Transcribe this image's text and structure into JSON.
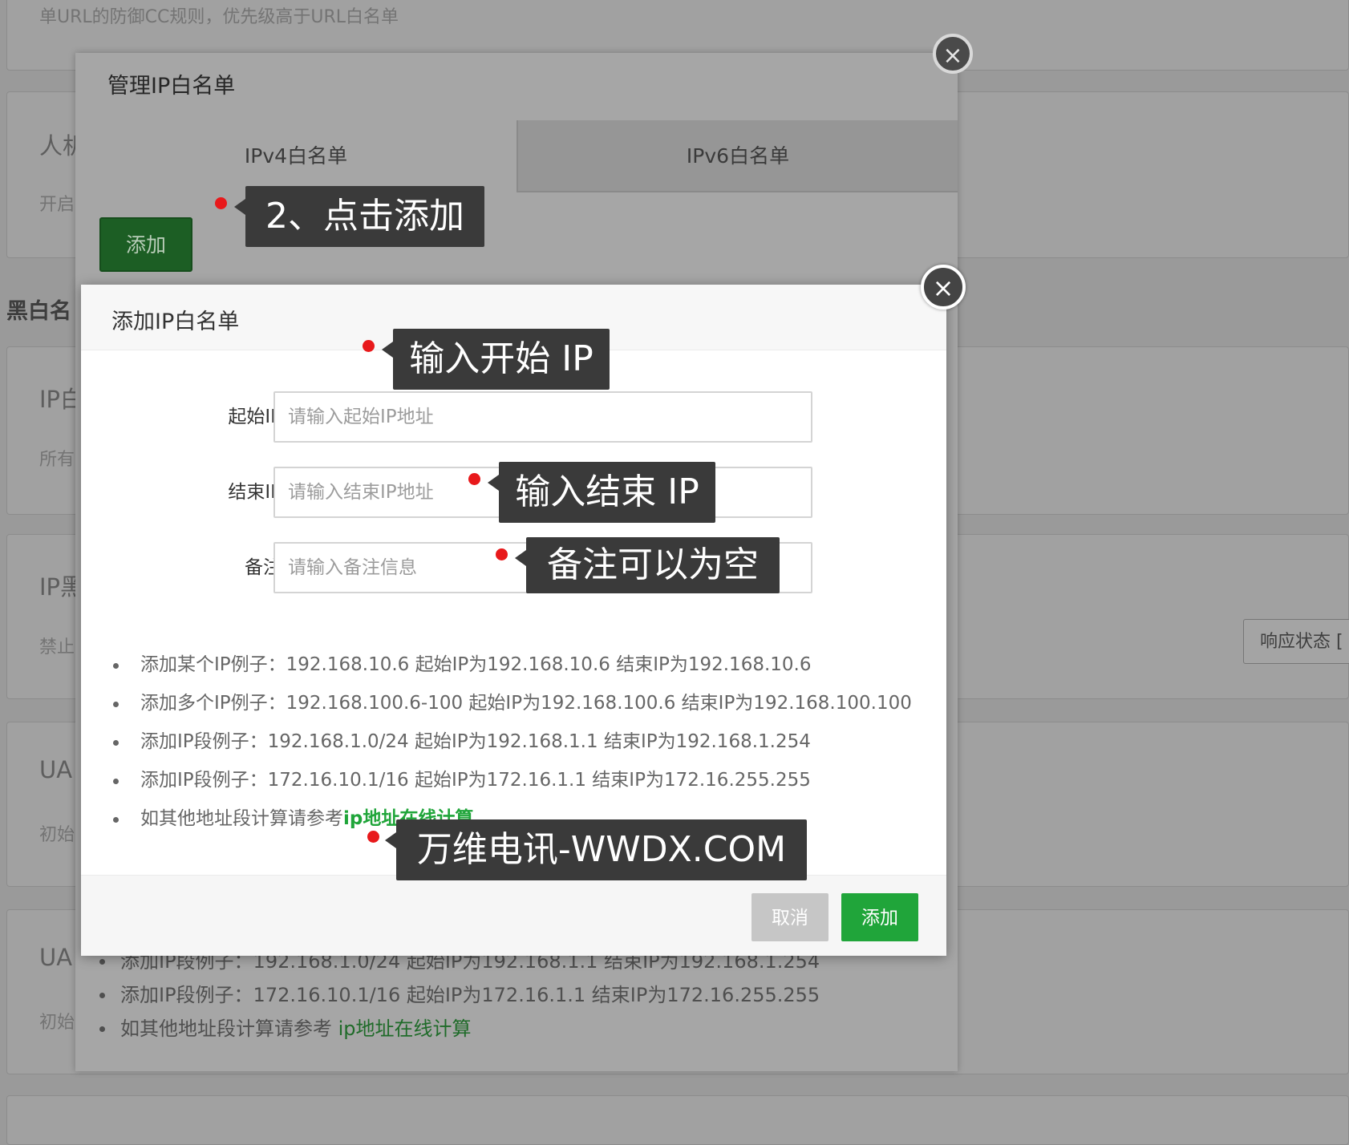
{
  "background_page": {
    "top_description": "单URL的防御CC规则，优先级高于URL白名单",
    "cards": [
      {
        "title": "人机",
        "desc": "开启"
      },
      {
        "title": "IP白",
        "desc": "所有"
      },
      {
        "title": "IP黑",
        "desc": "禁止"
      },
      {
        "title": "UA",
        "desc": "初始"
      },
      {
        "title": "UA",
        "desc": "初始"
      }
    ],
    "section_title": "黑白名",
    "response_status_button": "响应状态 ["
  },
  "outer_dialog": {
    "title": "管理IP白名单",
    "tabs": [
      {
        "label": "IPv4白名单",
        "active": true
      },
      {
        "label": "IPv6白名单",
        "active": false
      }
    ],
    "add_button": "添加",
    "close_icon": "×",
    "tips": [
      {
        "text": "添加IP段例子：192.168.1.0/24 起始IP为192.168.1.1 结束IP为192.168.1.254"
      },
      {
        "text": "添加IP段例子：172.16.10.1/16 起始IP为172.16.1.1 结束IP为172.16.255.255"
      },
      {
        "text": "如其他地址段计算请参考 ",
        "link": "ip地址在线计算"
      }
    ]
  },
  "inner_dialog": {
    "title": "添加IP白名单",
    "close_icon": "×",
    "fields": [
      {
        "label": "起始IP",
        "placeholder": "请输入起始IP地址",
        "value": ""
      },
      {
        "label": "结束IP",
        "placeholder": "请输入结束IP地址",
        "value": ""
      },
      {
        "label": "备注",
        "placeholder": "请输入备注信息",
        "value": ""
      }
    ],
    "tips": [
      {
        "text": "添加某个IP例子：192.168.10.6 起始IP为192.168.10.6 结束IP为192.168.10.6"
      },
      {
        "text": "添加多个IP例子：192.168.100.6-100 起始IP为192.168.100.6 结束IP为192.168.100.100"
      },
      {
        "text": "添加IP段例子：192.168.1.0/24 起始IP为192.168.1.1 结束IP为192.168.1.254"
      },
      {
        "text": "添加IP段例子：172.16.10.1/16 起始IP为172.16.1.1 结束IP为172.16.255.255"
      },
      {
        "text": "如其他地址段计算请参考",
        "link": "ip地址在线计算"
      }
    ],
    "cancel_button": "取消",
    "confirm_button": "添加"
  },
  "annotations": [
    {
      "text": "2、点击添加"
    },
    {
      "text": "输入开始 IP"
    },
    {
      "text": "输入结束 IP"
    },
    {
      "text": "备注可以为空"
    },
    {
      "text": "万维电讯-WWDX.COM"
    }
  ],
  "colors": {
    "primary_green": "#20a53a",
    "cancel_gray": "#c6c6c6",
    "annotation_bg": "#3a3a3a",
    "annotation_dot": "#e8191b"
  }
}
